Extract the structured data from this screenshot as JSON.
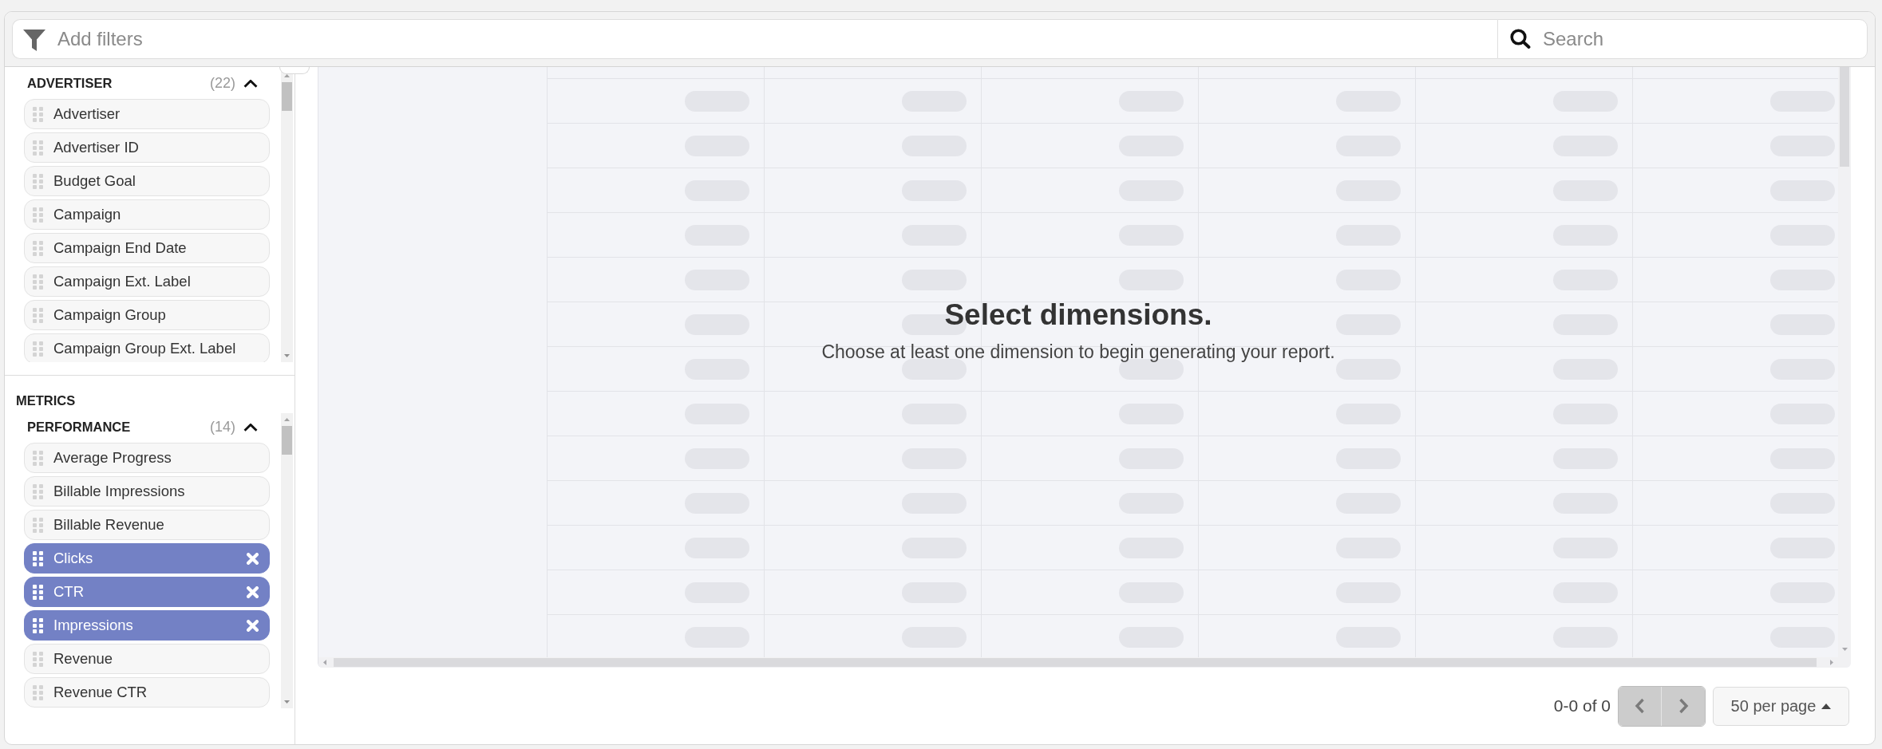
{
  "filter_bar": {
    "placeholder": "Add filters"
  },
  "search": {
    "placeholder": "Search"
  },
  "sidebar": {
    "dimension_groups": [
      {
        "title": "ADVERTISER",
        "count": "(22)",
        "expanded": true,
        "items": [
          {
            "label": "Advertiser",
            "selected": false
          },
          {
            "label": "Advertiser ID",
            "selected": false
          },
          {
            "label": "Budget Goal",
            "selected": false
          },
          {
            "label": "Campaign",
            "selected": false
          },
          {
            "label": "Campaign End Date",
            "selected": false
          },
          {
            "label": "Campaign Ext. Label",
            "selected": false
          },
          {
            "label": "Campaign Group",
            "selected": false
          },
          {
            "label": "Campaign Group Ext. Label",
            "selected": false
          }
        ]
      }
    ],
    "metrics_heading": "METRICS",
    "metric_groups": [
      {
        "title": "PERFORMANCE",
        "count": "(14)",
        "expanded": true,
        "items": [
          {
            "label": "Average Progress",
            "selected": false
          },
          {
            "label": "Billable Impressions",
            "selected": false
          },
          {
            "label": "Billable Revenue",
            "selected": false
          },
          {
            "label": "Clicks",
            "selected": true
          },
          {
            "label": "CTR",
            "selected": true
          },
          {
            "label": "Impressions",
            "selected": true
          },
          {
            "label": "Revenue",
            "selected": false
          },
          {
            "label": "Revenue CTR",
            "selected": false
          }
        ]
      }
    ]
  },
  "report": {
    "title": "Select dimensions.",
    "message": "Choose at least one dimension to begin generating your report."
  },
  "pagination": {
    "range": "0-0 of 0",
    "prev": {
      "disabled": true
    },
    "next": {
      "disabled": true
    },
    "page_size": "50 per page"
  }
}
